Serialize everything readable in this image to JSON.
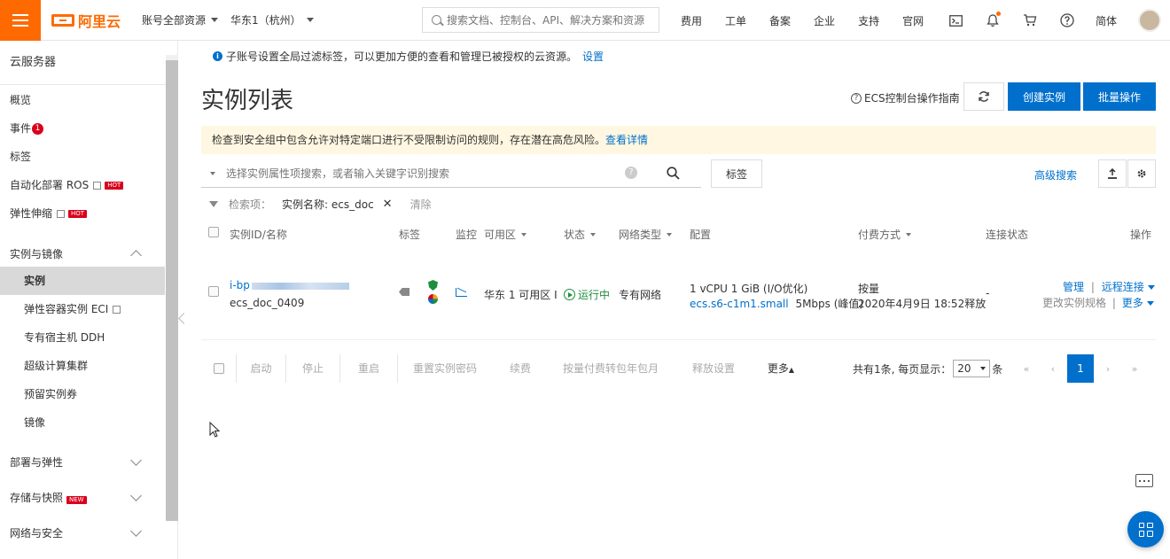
{
  "topbar": {
    "logo_text": "阿里云",
    "account_scope": "账号全部资源",
    "region": "华东1（杭州）",
    "search_placeholder": "搜索文档、控制台、API、解决方案和资源",
    "links": [
      "费用",
      "工单",
      "备案",
      "企业",
      "支持",
      "官网"
    ],
    "icons": [
      "terminal-icon",
      "bell-icon",
      "cart-icon",
      "help-icon"
    ],
    "language": "简体",
    "brand_color": "#ff6a00"
  },
  "sidebar": {
    "title": "云服务器",
    "items": [
      {
        "label": "概览"
      },
      {
        "label": "事件",
        "badge": "1"
      },
      {
        "label": "标签"
      },
      {
        "label": "自动化部署 ROS",
        "tag": "HOT"
      },
      {
        "label": "弹性伸缩",
        "tag": "HOT"
      }
    ],
    "group_instances": "实例与镜像",
    "instance_items": [
      "实例",
      "弹性容器实例 ECI",
      "专有宿主机 DDH",
      "超级计算集群",
      "预留实例券",
      "镜像"
    ],
    "groups": [
      {
        "label": "部署与弹性"
      },
      {
        "label": "存储与快照",
        "tag": "NEW"
      },
      {
        "label": "网络与安全"
      }
    ]
  },
  "main": {
    "info_note": "子账号设置全局过滤标签，可以更加方便的查看和管理已被授权的云资源。",
    "info_link": "设置",
    "title": "实例列表",
    "guide": "ECS控制台操作指南",
    "create_button": "创建实例",
    "bulk_button": "批量操作",
    "warning_text": "检查到安全组中包含允许对特定端口进行不受限制访问的规则，存在潜在高危风险。",
    "warning_link": "查看详情",
    "filter_placeholder": "选择实例属性项搜索，或者输入关键字识别搜索",
    "tag_button": "标签",
    "advanced_search": "高级搜索",
    "criteria_label": "检索项：",
    "criteria_value": "实例名称: ecs_doc",
    "criteria_clear": "清除",
    "accent_color": "#0070cc"
  },
  "table": {
    "headers": [
      "实例ID/名称",
      "标签",
      "监控",
      "可用区",
      "状态",
      "网络类型",
      "配置",
      "付费方式",
      "连接状态",
      "操作"
    ],
    "rows": [
      {
        "instance_id": "i-bp",
        "instance_name": "ecs_doc_0409",
        "zone": "华东 1 可用区 I",
        "status": "运行中",
        "network": "专有网络",
        "spec": "1 vCPU 1 GiB (I/O优化)",
        "instance_type": "ecs.s6-c1m1.small",
        "bandwidth": "5Mbps (峰值)",
        "billing": "按量",
        "release_time": "2020年4月9日 18:52释放",
        "connection": "-",
        "action_manage": "管理",
        "action_remote": "远程连接",
        "action_change": "更改实例规格",
        "action_more": "更多"
      }
    ]
  },
  "bulk_actions": [
    "启动",
    "停止",
    "重启",
    "重置实例密码",
    "续费",
    "按量付费转包年包月",
    "释放设置",
    "更多"
  ],
  "pagination": {
    "summary": "共有1条, 每页显示：",
    "page_size": "20",
    "unit": "条",
    "first": "«",
    "prev": "‹",
    "current": "1",
    "next": "›",
    "last": "»"
  }
}
